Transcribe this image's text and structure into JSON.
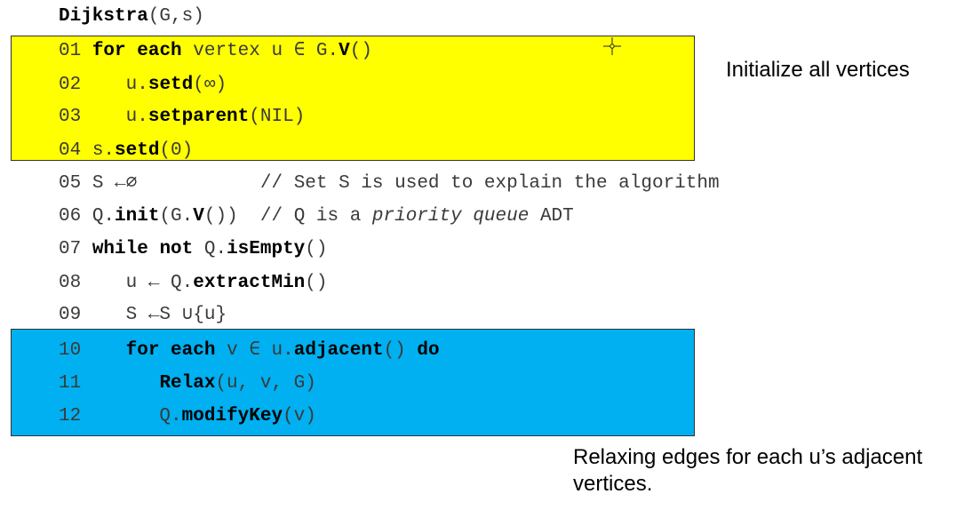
{
  "title": {
    "name": "Dijkstra",
    "args": "(G,s)"
  },
  "lines": [
    {
      "num": "01",
      "kw1": "for each",
      "t1": " vertex u ∈ G.",
      "kw2": "V",
      "t2": "()"
    },
    {
      "num": "02",
      "t1": "    u.",
      "kw1": "setd",
      "t2": "(∞)"
    },
    {
      "num": "03",
      "t1": "    u.",
      "kw1": "setparent",
      "t2": "(NIL)"
    },
    {
      "num": "04",
      "t1": " s.",
      "kw1": "setd",
      "t2": "(0)"
    },
    {
      "num": "05",
      "t1": " S ←∅           // Set S is used to explain the algorithm"
    },
    {
      "num": "06",
      "t1": " Q.",
      "kw1": "init",
      "t2": "(G.",
      "kw2": "V",
      "t3": "())  // Q is a ",
      "it": "priority queue",
      "t4": " ADT"
    },
    {
      "num": "07",
      "kw1": "while not",
      "t1": " Q.",
      "kw2": "isEmpty",
      "t2": "()"
    },
    {
      "num": "08",
      "t1": "    u ← Q.",
      "kw1": "extractMin",
      "t2": "()"
    },
    {
      "num": "09",
      "t1": "    S ←S ∪{u}"
    },
    {
      "num": "10",
      "t1": "    ",
      "kw1": "for each",
      "t2": " v ∈ u.",
      "kw2": "adjacent",
      "t3": "() ",
      "kw3": "do"
    },
    {
      "num": "11",
      "t1": "       ",
      "kw1": "Relax",
      "t2": "(u, v, G)"
    },
    {
      "num": "12",
      "t1": "       Q.",
      "kw1": "modifyKey",
      "t2": "(v)"
    }
  ],
  "annotations": {
    "initialize": "Initialize all vertices",
    "relax": "Relaxing edges for each u’s adjacent vertices."
  },
  "icons": {
    "cursor": "crosshair-cursor-icon"
  },
  "colors": {
    "highlight_init": "#ffff00",
    "highlight_relax": "#00b0f0"
  }
}
